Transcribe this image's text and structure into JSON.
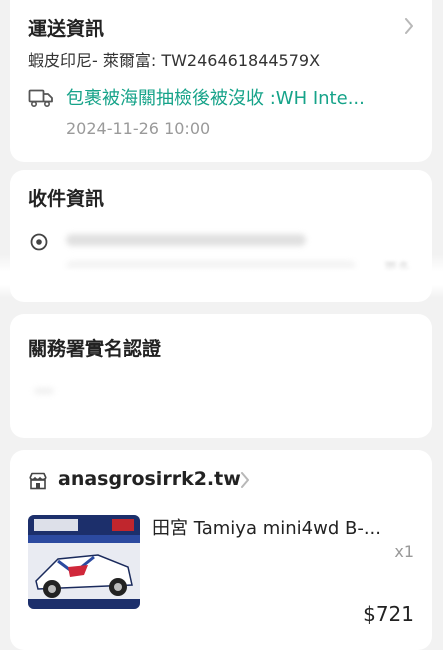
{
  "shipping": {
    "title": "運送資訊",
    "tracking": "蝦皮印尼- 萊爾富: TW246461844579X",
    "status": "包裹被海關抽檢後被沒收 :WH Inte...",
    "time": "2024-11-26 10:00"
  },
  "recipient": {
    "title": "收件資訊",
    "more": "更多"
  },
  "customs": {
    "title": "關務署實名認證"
  },
  "order": {
    "shop_name": "anasgrosirrk2.tw",
    "product_title": "田宮 Tamiya mini4wd B-...",
    "quantity": "x1",
    "price": "$721"
  },
  "colors": {
    "accent": "#16a389",
    "background": "#f2f2f2",
    "card": "#ffffff"
  },
  "icons": [
    "chevron-right-icon",
    "truck-icon",
    "location-pin-icon",
    "shop-icon"
  ]
}
